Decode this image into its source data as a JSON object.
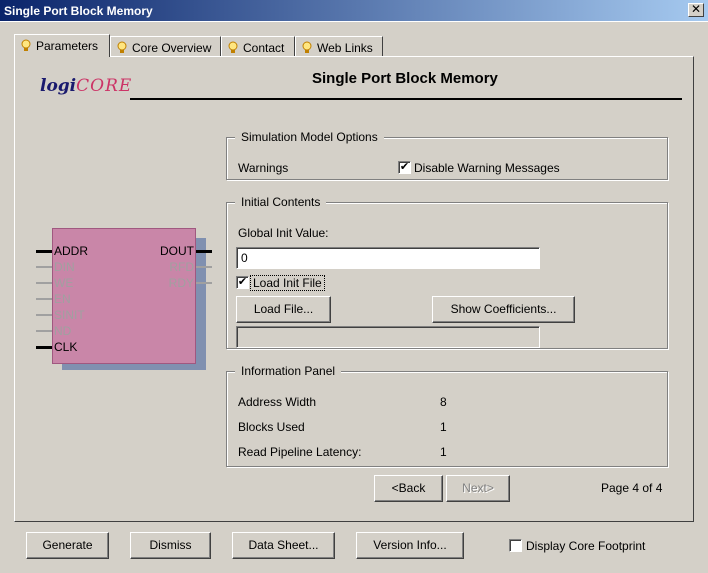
{
  "window": {
    "title": "Single Port Block Memory",
    "close": "✕"
  },
  "tabs": [
    {
      "label": "Parameters"
    },
    {
      "label": "Core Overview"
    },
    {
      "label": "Contact"
    },
    {
      "label": "Web Links"
    }
  ],
  "logo": {
    "logi": "logi",
    "core": "CORE"
  },
  "page_title": "Single Port Block Memory",
  "simulation": {
    "group_label": "Simulation Model Options",
    "warnings_label": "Warnings",
    "disable_warning_label": "Disable Warning Messages",
    "disable_warning_checked": "✔"
  },
  "initial": {
    "group_label": "Initial Contents",
    "global_init_label": "Global Init Value:",
    "global_init_value": "0",
    "load_init_label": "Load Init File",
    "load_init_checked": "✔",
    "load_file_button": "Load File...",
    "show_coeff_button": "Show Coefficients..."
  },
  "info": {
    "group_label": "Information Panel",
    "rows": [
      {
        "label": "Address Width",
        "value": "8"
      },
      {
        "label": "Blocks Used",
        "value": "1"
      },
      {
        "label": "Read Pipeline Latency:",
        "value": "1"
      }
    ]
  },
  "symbol": {
    "inputs": [
      {
        "name": "ADDR",
        "active": true
      },
      {
        "name": "DIN",
        "active": false
      },
      {
        "name": "WE",
        "active": false
      },
      {
        "name": "EN",
        "active": false
      },
      {
        "name": "SINIT",
        "active": false
      },
      {
        "name": "ND",
        "active": false
      },
      {
        "name": "CLK",
        "active": true
      }
    ],
    "outputs": [
      {
        "name": "DOUT",
        "active": true
      },
      {
        "name": "RFD",
        "active": false
      },
      {
        "name": "RDY",
        "active": false
      }
    ]
  },
  "nav": {
    "back": "<Back",
    "next": "Next>",
    "page": "Page 4 of 4"
  },
  "footer": {
    "generate": "Generate",
    "dismiss": "Dismiss",
    "data_sheet": "Data Sheet...",
    "version_info": "Version Info...",
    "display_footprint": "Display Core Footprint"
  },
  "colors": {
    "titlebar": "#0a246a",
    "block": "#c986a8",
    "block_shadow": "#8090b0",
    "logo_core": "#cc3366"
  }
}
